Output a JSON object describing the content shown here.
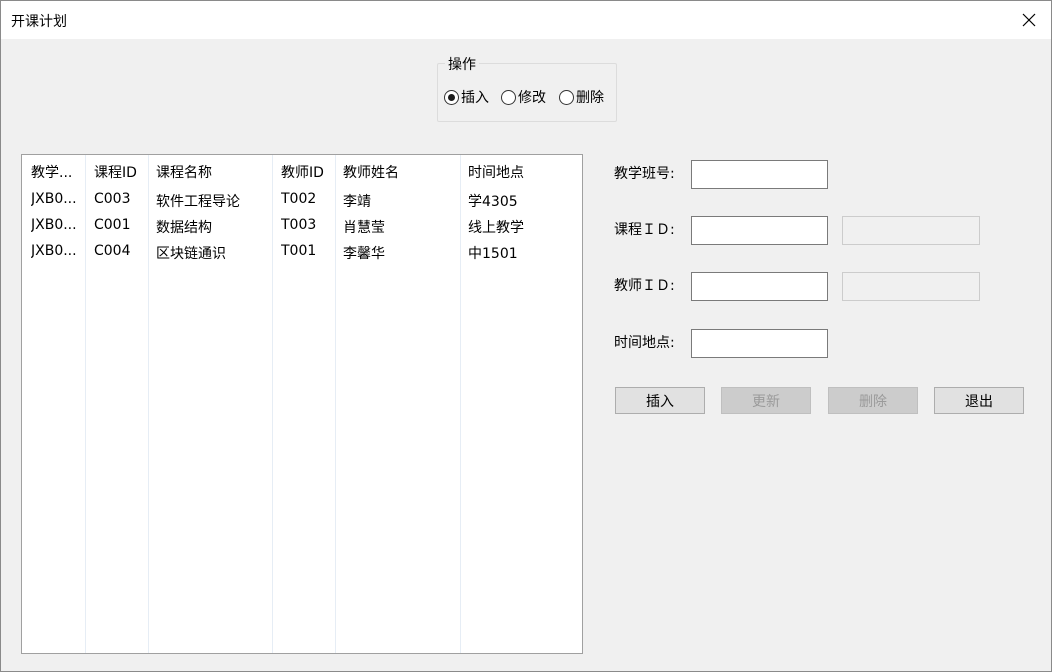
{
  "window": {
    "title": "开课计划"
  },
  "operation": {
    "label": "操作",
    "options": [
      "插入",
      "修改",
      "删除"
    ],
    "selected": "插入"
  },
  "table": {
    "columns": [
      "教学...",
      "课程ID",
      "课程名称",
      "教师ID",
      "教师姓名",
      "时间地点"
    ],
    "rows": [
      [
        "JXB0...",
        "C003",
        "软件工程导论",
        "T002",
        "李靖",
        "学4305"
      ],
      [
        "JXB0...",
        "C001",
        "数据结构",
        "T003",
        "肖慧莹",
        "线上教学"
      ],
      [
        "JXB0...",
        "C004",
        "区块链通识",
        "T001",
        "李馨华",
        "中1501"
      ]
    ]
  },
  "form": {
    "class_no_label": "教学班号:",
    "course_id_label": "课程ＩＤ:",
    "teacher_id_label": "教师ＩＤ:",
    "time_place_label": "时间地点:",
    "class_no_value": "",
    "course_id_value": "",
    "course_name_value": "",
    "teacher_id_value": "",
    "teacher_name_value": "",
    "time_place_value": ""
  },
  "buttons": {
    "insert": "插入",
    "update": "更新",
    "delete": "删除",
    "exit": "退出"
  }
}
